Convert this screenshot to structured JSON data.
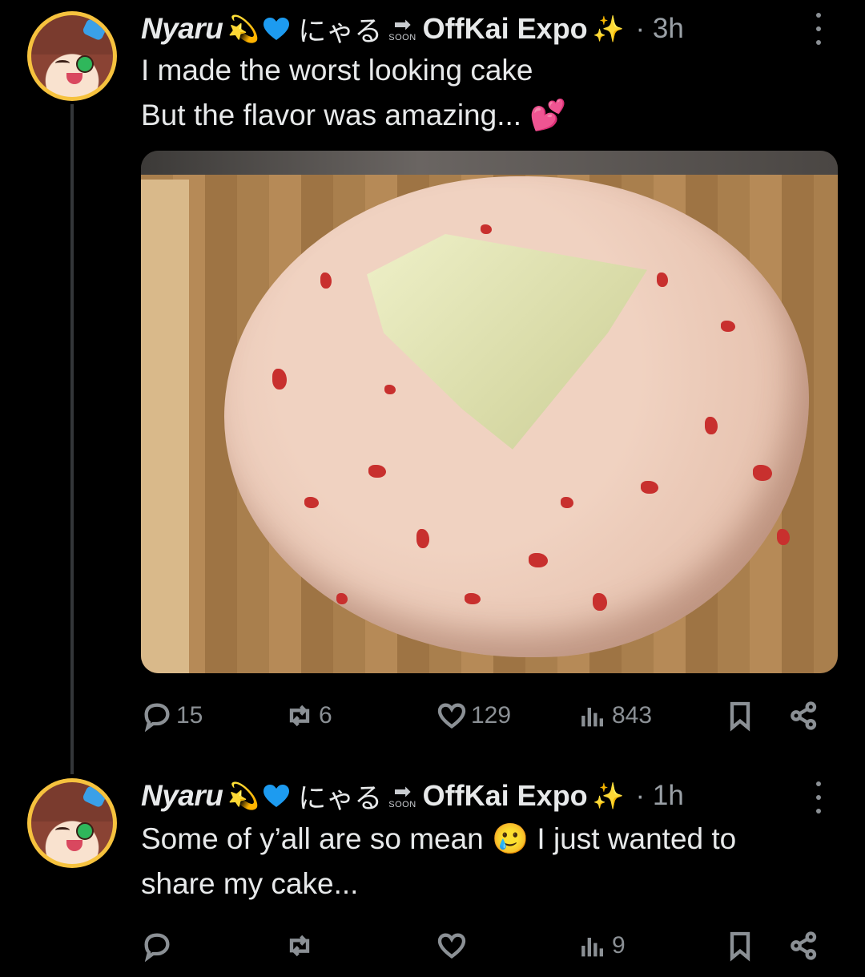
{
  "tweets": [
    {
      "author": {
        "display_name": "Nyaru",
        "emoji_1": "💫",
        "jp_name": "にゃる",
        "soon_label": "SOON",
        "event_name": "OffKai Expo",
        "emoji_2": "✨"
      },
      "time": "· 3h",
      "text_lines": [
        "I made the worst looking cake",
        "But the flavor was amazing... 💕"
      ],
      "stats": {
        "replies": "15",
        "reposts": "6",
        "likes": "129",
        "views": "843"
      }
    },
    {
      "author": {
        "display_name": "Nyaru",
        "emoji_1": "💫",
        "jp_name": "にゃる",
        "soon_label": "SOON",
        "event_name": "OffKai Expo",
        "emoji_2": "✨"
      },
      "time": "· 1h",
      "text_lines": [
        "Some of y’all are so mean 🥲 I just wanted to",
        "share my cake..."
      ],
      "stats": {
        "replies": "",
        "reposts": "",
        "likes": "",
        "views": "9"
      }
    }
  ],
  "icons": {
    "reply": "reply-icon",
    "repost": "repost-icon",
    "like": "heart-icon",
    "views": "views-icon",
    "bookmark": "bookmark-icon",
    "share": "share-icon",
    "more": "more-icon"
  },
  "colors": {
    "background": "#000000",
    "text": "#e7e9ea",
    "muted": "#8b9095",
    "blue_heart": "#1d9bf0",
    "avatar_ring": "#f6c23e"
  }
}
